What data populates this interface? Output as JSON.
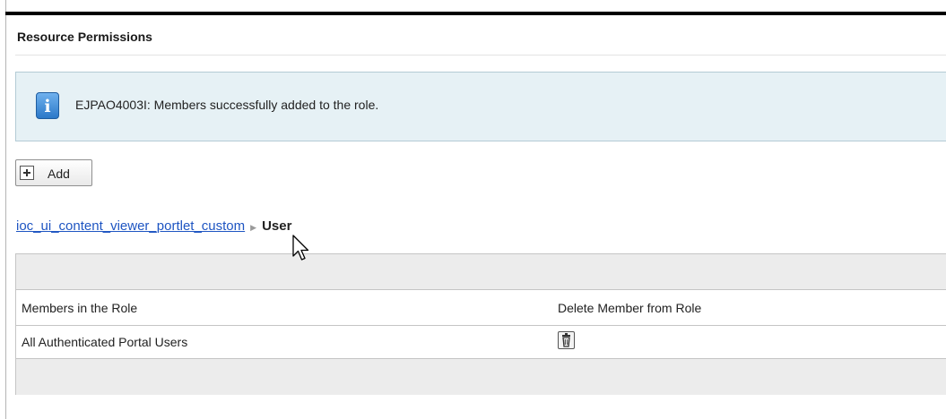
{
  "page": {
    "title": "Resource Permissions"
  },
  "message": {
    "text": "EJPAO4003I: Members successfully added to the role.",
    "icon": "info-icon",
    "icon_glyph": "i"
  },
  "toolbar": {
    "add_label": "Add",
    "add_icon": "plus-icon"
  },
  "breadcrumb": {
    "resource": "ioc_ui_content_viewer_portlet_custom",
    "separator": "▶",
    "current": "User"
  },
  "table": {
    "columns": [
      "Members in the Role",
      "Delete Member from Role"
    ],
    "rows": [
      {
        "member": "All Authenticated Portal Users",
        "delete_icon": "trash-icon"
      }
    ]
  },
  "colors": {
    "link": "#1e55c2",
    "message_bg": "#e6f1f5",
    "info_icon": "#2b78c8",
    "table_bar": "#ececec"
  }
}
